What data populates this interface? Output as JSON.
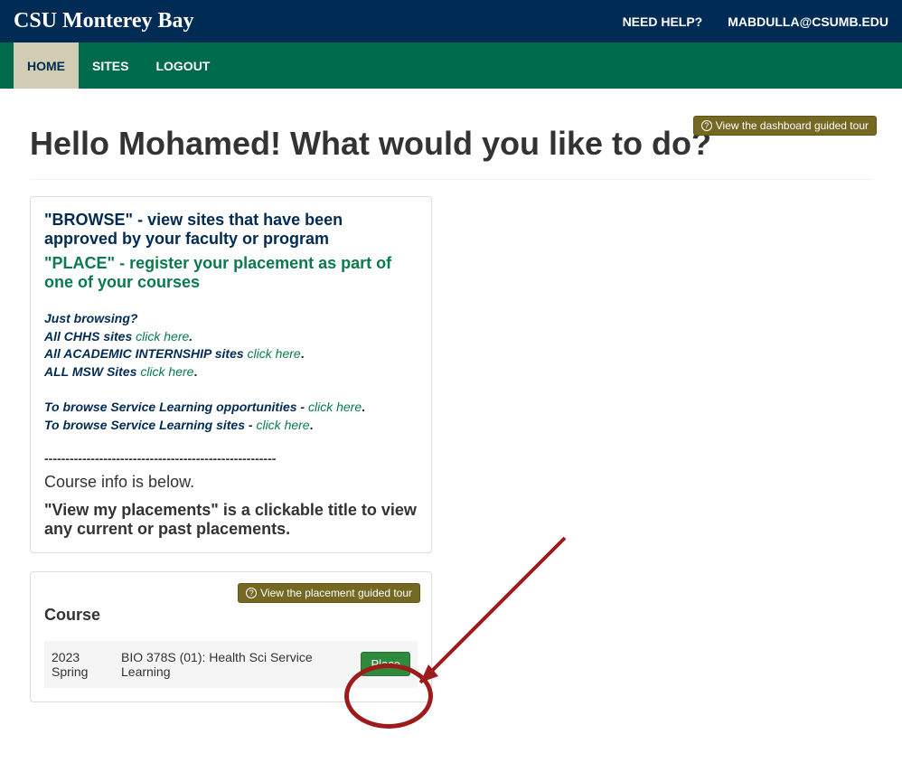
{
  "header": {
    "brand": "CSU Monterey Bay",
    "help": "NEED HELP?",
    "user": "MABDULLA@CSUMB.EDU"
  },
  "nav": {
    "home": "HOME",
    "sites": "SITES",
    "logout": "LOGOUT"
  },
  "dashboard": {
    "tour_btn": "View the dashboard guided tour",
    "greeting": "Hello Mohamed! What would you like to do?",
    "browse_head": "\"BROWSE\"",
    "browse_rest": " - view sites that have been approved by your faculty or program",
    "place_head": "\"PLACE\"",
    "place_rest": " - register your placement as part of one of your courses",
    "browsing_q": "Just browsing?",
    "chhs_pre": "All CHHS sites ",
    "click_here": "click here",
    "period": ".",
    "intern_pre": "All ACADEMIC INTERNSHIP sites ",
    "msw_pre": "ALL MSW Sites ",
    "sl_opp_pre": "To browse Service Learning opportunities - ",
    "sl_sites_pre": "To browse Service Learning sites - ",
    "dashes": "-------------------------------------------------------",
    "course_info": "Course info is below.",
    "placements_hint": "\"View my placements\" is a clickable title to view any current or past placements."
  },
  "course_panel": {
    "tour_btn": "View the placement guided tour",
    "title": "Course",
    "row": {
      "term": "2023 Spring",
      "name": "BIO 378S (01): Health Sci Service Learning",
      "place_btn": "Place"
    }
  }
}
